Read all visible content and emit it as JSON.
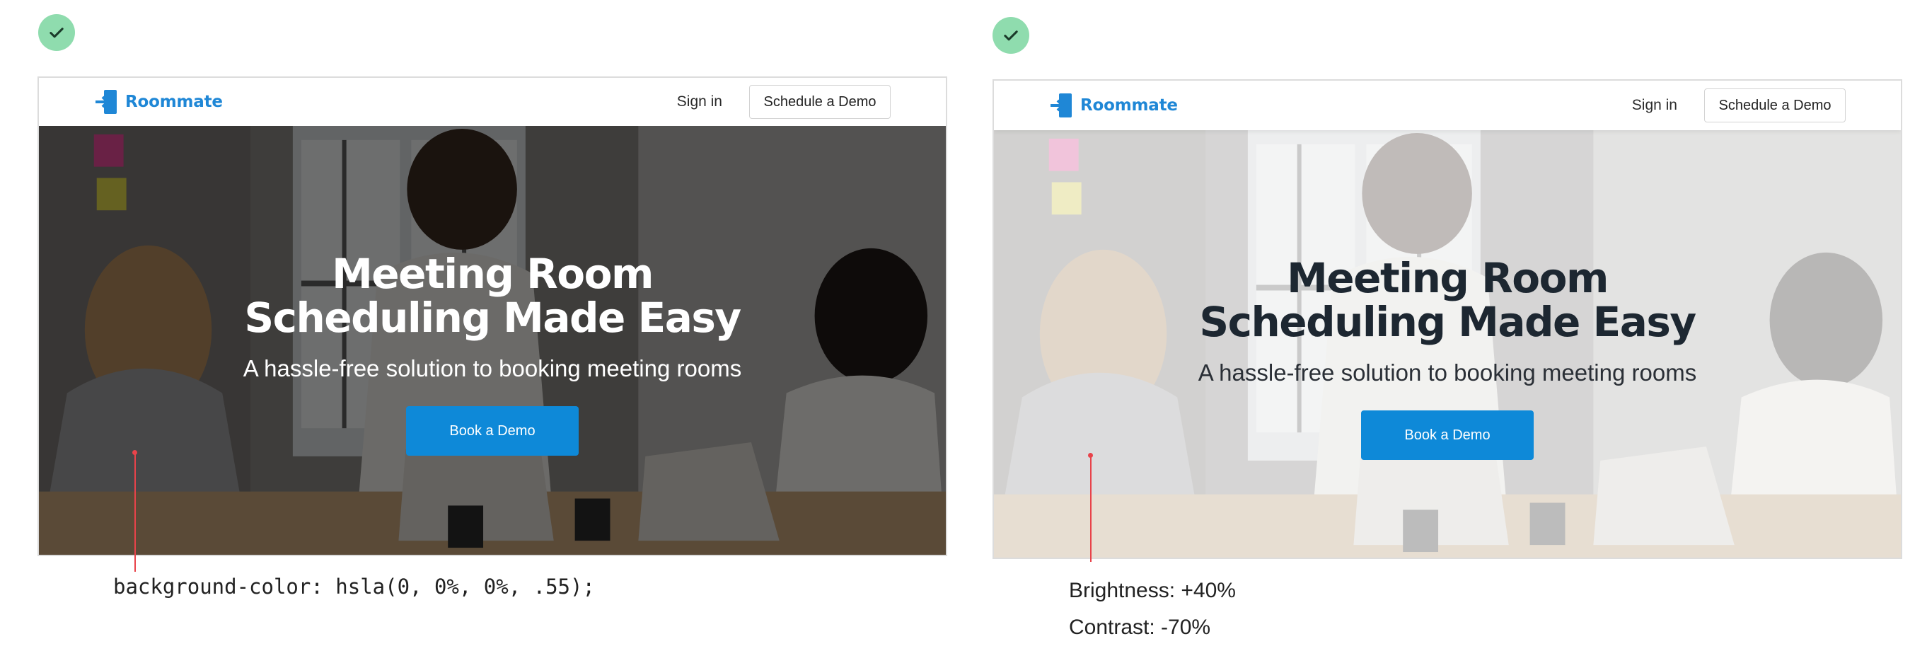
{
  "examples": [
    {
      "nav": {
        "brand": "Roommate",
        "signin": "Sign in",
        "demo": "Schedule a Demo"
      },
      "hero": {
        "title": "Meeting Room Scheduling Made Easy",
        "subtitle": "A hassle-free solution to booking meeting rooms",
        "cta": "Book a Demo"
      },
      "caption": "background-color: hsla(0, 0%, 0%, .55);"
    },
    {
      "nav": {
        "brand": "Roommate",
        "signin": "Sign in",
        "demo": "Schedule a Demo"
      },
      "hero": {
        "title": "Meeting Room Scheduling Made Easy",
        "subtitle": "A hassle-free solution to booking meeting rooms",
        "cta": "Book a Demo"
      },
      "caption_lines": [
        "Brightness: +40%",
        "Contrast: -70%"
      ]
    }
  ],
  "icons": {
    "status": "checkmark-icon",
    "logo": "door-enter-icon"
  },
  "colors": {
    "brand": "#1f87d6",
    "cta": "#0e89d8",
    "check": "#8fdcae",
    "pointer": "#e8434a"
  }
}
